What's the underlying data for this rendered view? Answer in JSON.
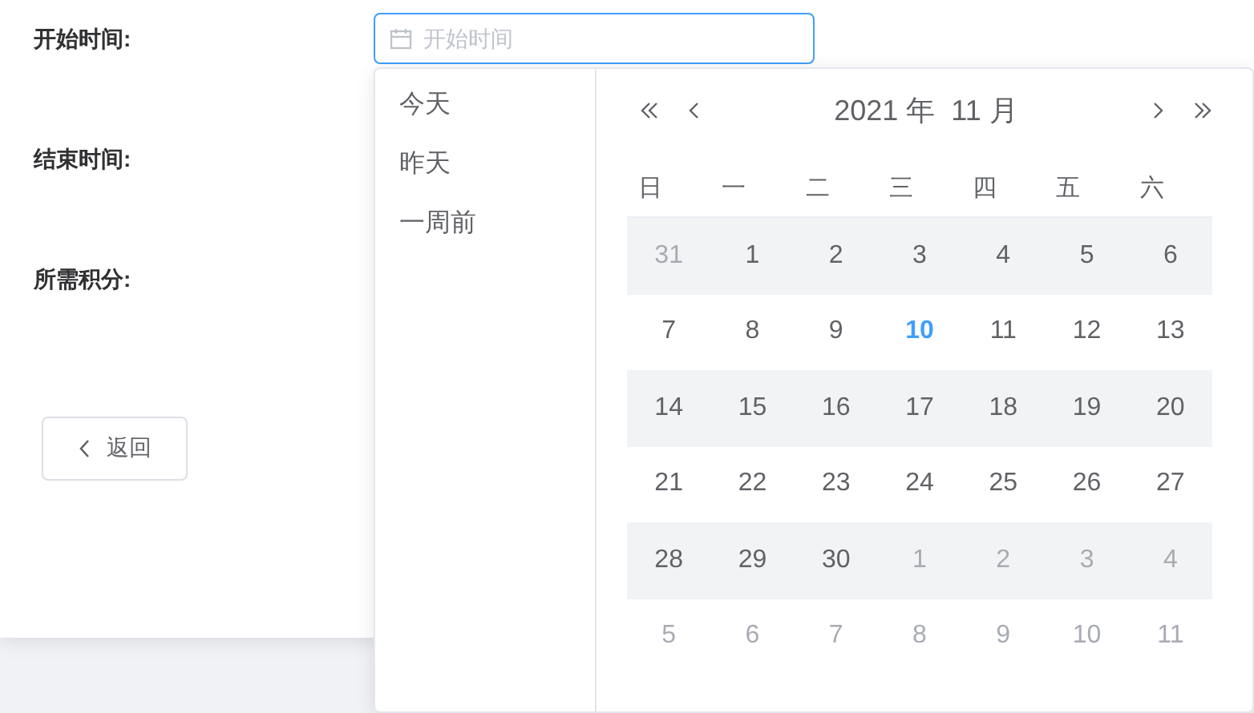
{
  "form": {
    "fields": [
      {
        "label": "开始时间:"
      },
      {
        "label": "结束时间:"
      },
      {
        "label": "所需积分:"
      }
    ],
    "start_input": {
      "placeholder": "开始时间"
    },
    "back_button": {
      "label": "返回"
    }
  },
  "date_picker": {
    "shortcuts": [
      "今天",
      "昨天",
      "一周前"
    ],
    "header": {
      "title": "2021 年  11 月"
    },
    "weekdays": [
      "日",
      "一",
      "二",
      "三",
      "四",
      "五",
      "六"
    ],
    "weeks": [
      {
        "shaded": true,
        "days": [
          {
            "text": "31",
            "kind": "other"
          },
          {
            "text": "1",
            "kind": "current"
          },
          {
            "text": "2",
            "kind": "current"
          },
          {
            "text": "3",
            "kind": "current"
          },
          {
            "text": "4",
            "kind": "current"
          },
          {
            "text": "5",
            "kind": "current"
          },
          {
            "text": "6",
            "kind": "current"
          }
        ]
      },
      {
        "shaded": false,
        "days": [
          {
            "text": "7",
            "kind": "current"
          },
          {
            "text": "8",
            "kind": "current"
          },
          {
            "text": "9",
            "kind": "current"
          },
          {
            "text": "10",
            "kind": "today"
          },
          {
            "text": "11",
            "kind": "current"
          },
          {
            "text": "12",
            "kind": "current"
          },
          {
            "text": "13",
            "kind": "current"
          }
        ]
      },
      {
        "shaded": true,
        "days": [
          {
            "text": "14",
            "kind": "current"
          },
          {
            "text": "15",
            "kind": "current"
          },
          {
            "text": "16",
            "kind": "current"
          },
          {
            "text": "17",
            "kind": "current"
          },
          {
            "text": "18",
            "kind": "current"
          },
          {
            "text": "19",
            "kind": "current"
          },
          {
            "text": "20",
            "kind": "current"
          }
        ]
      },
      {
        "shaded": false,
        "days": [
          {
            "text": "21",
            "kind": "current"
          },
          {
            "text": "22",
            "kind": "current"
          },
          {
            "text": "23",
            "kind": "current"
          },
          {
            "text": "24",
            "kind": "current"
          },
          {
            "text": "25",
            "kind": "current"
          },
          {
            "text": "26",
            "kind": "current"
          },
          {
            "text": "27",
            "kind": "current"
          }
        ]
      },
      {
        "shaded": true,
        "days": [
          {
            "text": "28",
            "kind": "current"
          },
          {
            "text": "29",
            "kind": "current"
          },
          {
            "text": "30",
            "kind": "current"
          },
          {
            "text": "1",
            "kind": "other"
          },
          {
            "text": "2",
            "kind": "other"
          },
          {
            "text": "3",
            "kind": "other"
          },
          {
            "text": "4",
            "kind": "other"
          }
        ]
      },
      {
        "shaded": false,
        "days": [
          {
            "text": "5",
            "kind": "other"
          },
          {
            "text": "6",
            "kind": "other"
          },
          {
            "text": "7",
            "kind": "other"
          },
          {
            "text": "8",
            "kind": "other"
          },
          {
            "text": "9",
            "kind": "other"
          },
          {
            "text": "10",
            "kind": "other"
          },
          {
            "text": "11",
            "kind": "other"
          }
        ]
      }
    ]
  }
}
